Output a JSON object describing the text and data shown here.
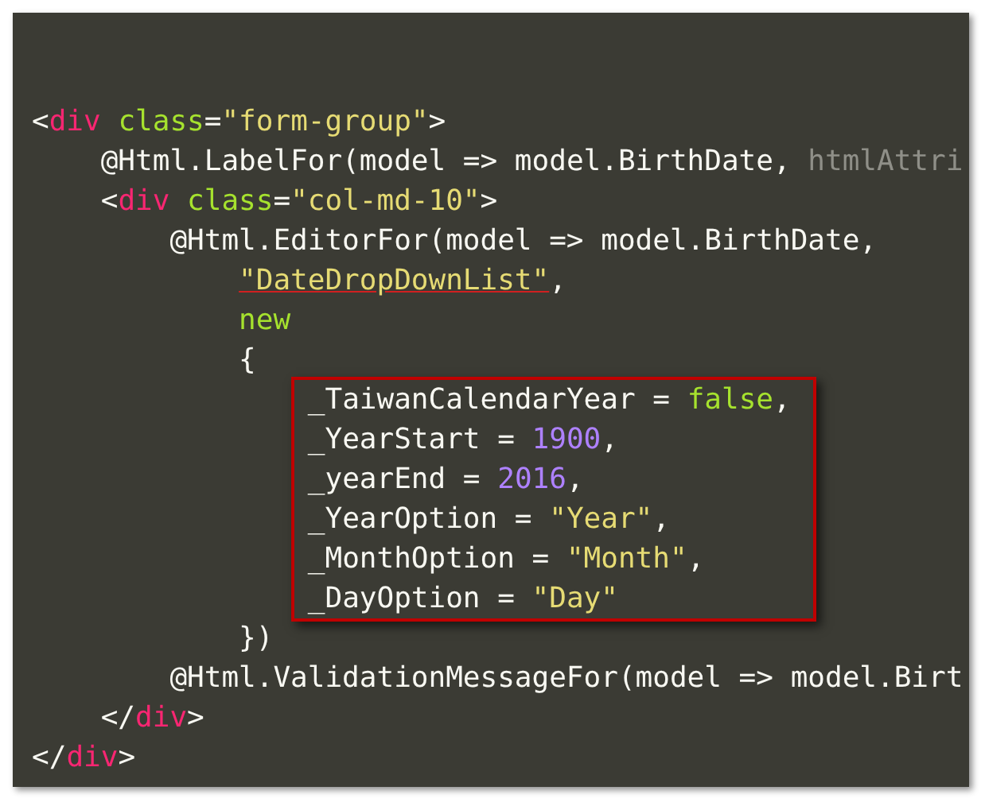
{
  "editor": {
    "lines": [
      {
        "highlighted": false,
        "tokens": [
          {
            "kind": "punct",
            "text": "<"
          },
          {
            "kind": "tag",
            "text": "div"
          },
          {
            "kind": "attr",
            "text": "class"
          },
          {
            "kind": "punct",
            "text": "="
          },
          {
            "kind": "string",
            "text": "\"form-group\""
          },
          {
            "kind": "punct",
            "text": ">"
          }
        ],
        "children": [
          {
            "highlighted": false,
            "tokens": [
              {
                "kind": "plain",
                "text": "@Html.LabelFor(model => model.BirthDate,"
              },
              {
                "kind": "dim",
                "text": "htmlAttri"
              }
            ]
          },
          {
            "highlighted": false,
            "tokens": [
              {
                "kind": "punct",
                "text": "<"
              },
              {
                "kind": "tag",
                "text": "div"
              },
              {
                "kind": "attr",
                "text": "class"
              },
              {
                "kind": "punct",
                "text": "="
              },
              {
                "kind": "string",
                "text": "\"col-md-10\""
              },
              {
                "kind": "punct",
                "text": ">"
              }
            ],
            "children": [
              {
                "highlighted": false,
                "tokens": [
                  {
                    "kind": "plain",
                    "text": "@Html.EditorFor(model => model.BirthDate,"
                  }
                ],
                "children": [
                  {
                    "highlighted": false,
                    "tokens": [
                      {
                        "kind": "string",
                        "text": "\"DateDropDownList\"",
                        "underlined": true
                      },
                      {
                        "kind": "plain",
                        "text": ","
                      }
                    ]
                  },
                  {
                    "highlighted": false,
                    "tokens": [
                      {
                        "kind": "keyword",
                        "text": "new"
                      }
                    ]
                  },
                  {
                    "highlighted": false,
                    "tokens": [
                      {
                        "kind": "plain",
                        "text": "{"
                      }
                    ],
                    "children": [
                      {
                        "highlighted": true,
                        "tokens": [
                          {
                            "kind": "plain",
                            "text": "_TaiwanCalendarYear = "
                          },
                          {
                            "kind": "keyword",
                            "text": "false"
                          },
                          {
                            "kind": "plain",
                            "text": ","
                          }
                        ]
                      },
                      {
                        "highlighted": true,
                        "tokens": [
                          {
                            "kind": "plain",
                            "text": "_YearStart = "
                          },
                          {
                            "kind": "number",
                            "text": "1900"
                          },
                          {
                            "kind": "plain",
                            "text": ","
                          }
                        ]
                      },
                      {
                        "highlighted": true,
                        "tokens": [
                          {
                            "kind": "plain",
                            "text": "_yearEnd = "
                          },
                          {
                            "kind": "number",
                            "text": "2016"
                          },
                          {
                            "kind": "plain",
                            "text": ","
                          }
                        ]
                      },
                      {
                        "highlighted": true,
                        "tokens": [
                          {
                            "kind": "plain",
                            "text": "_YearOption = "
                          },
                          {
                            "kind": "string",
                            "text": "\"Year\""
                          },
                          {
                            "kind": "plain",
                            "text": ","
                          }
                        ]
                      },
                      {
                        "highlighted": true,
                        "tokens": [
                          {
                            "kind": "plain",
                            "text": "_MonthOption = "
                          },
                          {
                            "kind": "string",
                            "text": "\"Month\""
                          },
                          {
                            "kind": "plain",
                            "text": ","
                          }
                        ]
                      },
                      {
                        "highlighted": true,
                        "tokens": [
                          {
                            "kind": "plain",
                            "text": "_DayOption = "
                          },
                          {
                            "kind": "string",
                            "text": "\"Day\""
                          }
                        ]
                      }
                    ]
                  },
                  {
                    "highlighted": false,
                    "tokens": [
                      {
                        "kind": "plain",
                        "text": "})"
                      }
                    ]
                  }
                ]
              },
              {
                "highlighted": false,
                "tokens": [
                  {
                    "kind": "plain",
                    "text": "@Html.ValidationMessageFor(model => model.Birt"
                  }
                ]
              }
            ]
          },
          {
            "highlighted": false,
            "tokens": [
              {
                "kind": "punct",
                "text": "</"
              },
              {
                "kind": "tag",
                "text": "div"
              },
              {
                "kind": "punct",
                "text": ">"
              }
            ]
          }
        ]
      },
      {
        "highlighted": false,
        "tokens": [
          {
            "kind": "punct",
            "text": "</"
          },
          {
            "kind": "tag",
            "text": "div"
          },
          {
            "kind": "punct",
            "text": ">"
          }
        ]
      }
    ]
  }
}
